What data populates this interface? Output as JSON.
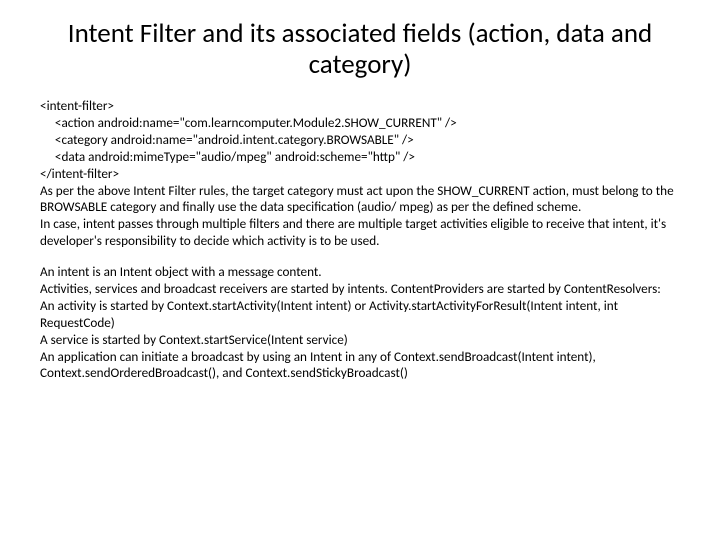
{
  "title": "Intent Filter and its associated fields (action, data and category)",
  "code": {
    "l1": "<intent-filter>",
    "l2": "     <action android:name=\"com.learncomputer.Module2.SHOW_CURRENT\" />",
    "l3": "     <category android:name=\"android.intent.category.BROWSABLE\" />",
    "l4": "     <data android:mimeType=\"audio/mpeg\" android:scheme=\"http\" />",
    "l5": "</intent-filter>"
  },
  "p1": "As per the above Intent Filter rules, the target category must act upon the SHOW_CURRENT action, must belong to the BROWSABLE category and finally use the data specification (audio/ mpeg) as per the defined scheme.",
  "p2": "In case, intent passes through multiple filters and there are multiple target activities eligible to receive that intent, it's developer's responsibility to decide which activity is to be used.",
  "p3": "An intent is an Intent object with a message content.",
  "p4": "Activities, services and broadcast receivers are started by intents. ContentProviders are started by ContentResolvers:",
  "p5": "An activity is started by Context.startActivity(Intent intent) or Activity.startActivityForResult(Intent intent, int RequestCode)",
  "p6": "A service is started by  Context.startService(Intent service)",
  "p7": "An application can initiate a broadcast by using an Intent in any of Context.sendBroadcast(Intent intent), Context.sendOrderedBroadcast(), and Context.sendStickyBroadcast()"
}
